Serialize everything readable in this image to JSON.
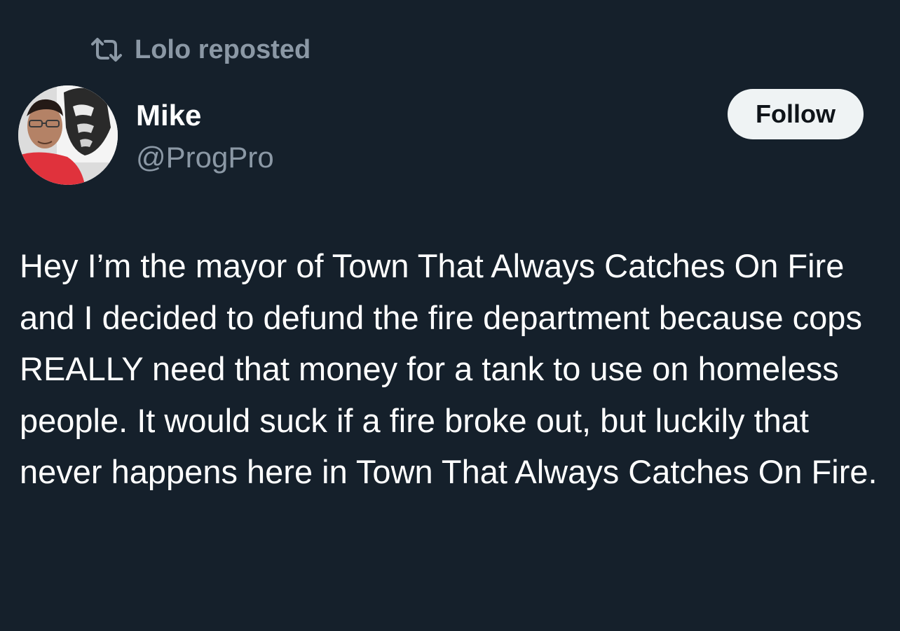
{
  "repost": {
    "label": "Lolo reposted",
    "icon": "repost-icon"
  },
  "author": {
    "name": "Mike",
    "handle": "@ProgPro",
    "avatar": "avatar"
  },
  "follow_button": {
    "label": "Follow"
  },
  "post": {
    "text": "Hey I’m the mayor of Town That Always Catches On Fire and I decided to defund the fire department because cops REALLY need that money for a tank to use on homeless people. It would suck if a fire broke out, but luckily that never happens here in Town That Always Catches On Fire."
  },
  "colors": {
    "background": "#15202b",
    "secondary_text": "#8b98a5",
    "primary_text": "#ffffff",
    "follow_bg": "#eff3f4"
  }
}
